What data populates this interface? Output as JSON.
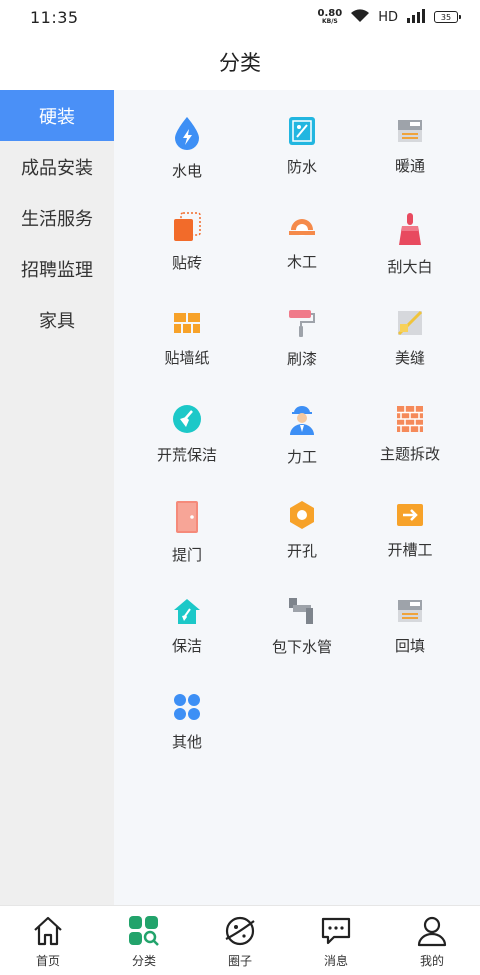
{
  "status": {
    "time": "11:35",
    "net_speed": "0.80",
    "net_unit": "KB/S",
    "network": "HD",
    "battery": "35"
  },
  "header": {
    "title": "分类"
  },
  "sidebar": {
    "items": [
      {
        "label": "硬装",
        "active": true
      },
      {
        "label": "成品安装"
      },
      {
        "label": "生活服务"
      },
      {
        "label": "招聘监理"
      },
      {
        "label": "家具"
      }
    ]
  },
  "categories": [
    {
      "label": "水电",
      "icon": "water-drop-icon"
    },
    {
      "label": "防水",
      "icon": "waterproof-icon"
    },
    {
      "label": "暖通",
      "icon": "heating-icon"
    },
    {
      "label": "贴砖",
      "icon": "tile-icon"
    },
    {
      "label": "木工",
      "icon": "saw-icon"
    },
    {
      "label": "刮大白",
      "icon": "brush-icon"
    },
    {
      "label": "贴墙纸",
      "icon": "wallpaper-icon"
    },
    {
      "label": "刷漆",
      "icon": "paint-roller-icon"
    },
    {
      "label": "美缝",
      "icon": "tile-grout-icon"
    },
    {
      "label": "开荒保洁",
      "icon": "broom-icon"
    },
    {
      "label": "力工",
      "icon": "worker-icon"
    },
    {
      "label": "主题拆改",
      "icon": "brick-wall-icon"
    },
    {
      "label": "提门",
      "icon": "door-icon"
    },
    {
      "label": "开孔",
      "icon": "hex-nut-icon"
    },
    {
      "label": "开槽工",
      "icon": "groove-icon"
    },
    {
      "label": "保洁",
      "icon": "house-clean-icon"
    },
    {
      "label": "包下水管",
      "icon": "pipe-icon"
    },
    {
      "label": "回填",
      "icon": "backfill-icon"
    },
    {
      "label": "其他",
      "icon": "four-petal-icon"
    }
  ],
  "tabbar": {
    "items": [
      {
        "label": "首页",
        "icon": "home-icon"
      },
      {
        "label": "分类",
        "icon": "category-icon",
        "active": true
      },
      {
        "label": "圈子",
        "icon": "planet-icon"
      },
      {
        "label": "消息",
        "icon": "message-icon"
      },
      {
        "label": "我的",
        "icon": "profile-icon"
      }
    ]
  },
  "colors": {
    "accent": "#4a90f7",
    "active_tab": "#22a36b",
    "sidebar_bg": "#efefef",
    "main_bg": "#f5f7fa"
  }
}
